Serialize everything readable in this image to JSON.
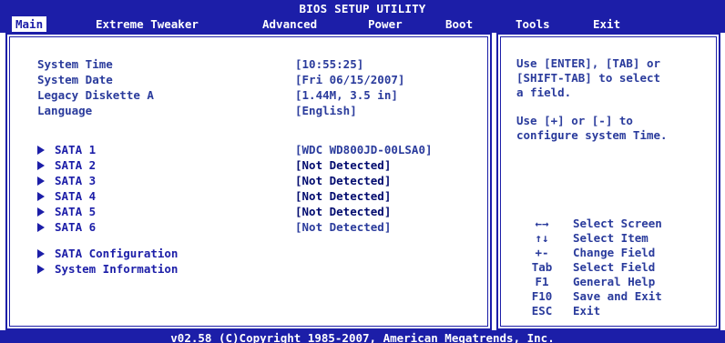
{
  "header": {
    "title": "BIOS SETUP UTILITY",
    "tabs": [
      {
        "label": "Main"
      },
      {
        "label": "Extreme Tweaker"
      },
      {
        "label": "Advanced"
      },
      {
        "label": "Power"
      },
      {
        "label": "Boot"
      },
      {
        "label": "Tools"
      },
      {
        "label": "Exit"
      }
    ],
    "active_tab": "Main"
  },
  "main": {
    "settings": [
      {
        "label": "System Time",
        "value": "[10:55:25]"
      },
      {
        "label": "System Date",
        "value": "[Fri 06/15/2007]"
      },
      {
        "label": "Legacy Diskette A",
        "value": "[1.44M, 3.5 in]"
      },
      {
        "label": "Language",
        "value": "[English]"
      }
    ],
    "sata": [
      {
        "label": "SATA 1",
        "value": "[WDC WD800JD-00LSA0]"
      },
      {
        "label": "SATA 2",
        "value": "[Not Detected]"
      },
      {
        "label": "SATA 3",
        "value": "[Not Detected]"
      },
      {
        "label": "SATA 4",
        "value": "[Not Detected]"
      },
      {
        "label": "SATA 5",
        "value": "[Not Detected]"
      },
      {
        "label": "SATA 6",
        "value": "[Not Detected]"
      }
    ],
    "submenus": [
      {
        "label": "SATA Configuration"
      },
      {
        "label": "System Information"
      }
    ]
  },
  "help": {
    "lines1": [
      "Use [ENTER], [TAB] or",
      "[SHIFT-TAB] to select",
      "a field."
    ],
    "lines2": [
      "Use [+] or [-] to",
      "configure system Time."
    ],
    "keys": [
      {
        "key": "←→",
        "desc": "Select Screen"
      },
      {
        "key": "↑↓",
        "desc": "Select Item"
      },
      {
        "key": "+-",
        "desc": "Change Field"
      },
      {
        "key": "Tab",
        "desc": "Select Field"
      },
      {
        "key": "F1",
        "desc": "General Help"
      },
      {
        "key": "F10",
        "desc": "Save and Exit"
      },
      {
        "key": "ESC",
        "desc": "Exit"
      }
    ]
  },
  "footer": {
    "text": "v02.58 (C)Copyright 1985-2007, American Megatrends, Inc."
  },
  "colors": {
    "bar_blue": "#1c1ea8",
    "text_blue": "#2a3b9c",
    "background": "#ffffff"
  }
}
